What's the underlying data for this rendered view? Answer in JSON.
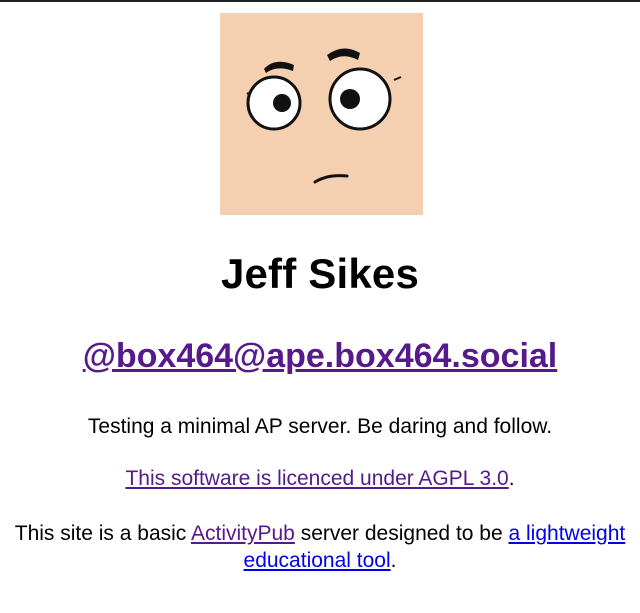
{
  "profile": {
    "avatar_alt": "Cartoon face avatar",
    "name": "Jeff Sikes",
    "handle": "@box464@ape.box464.social",
    "bio": "Testing a minimal AP server. Be daring and follow."
  },
  "licence": {
    "link_text": "This software is licenced under AGPL 3.0",
    "suffix": "."
  },
  "about": {
    "prefix": "This site is a basic ",
    "activitypub_link": "ActivityPub",
    "middle": " server designed to be ",
    "tool_link": "a lightweight educational tool",
    "suffix": "."
  },
  "colors": {
    "avatar_skin": "#f5d0b0",
    "visited_link": "#551a8b",
    "unvisited_link": "#0000ee"
  }
}
